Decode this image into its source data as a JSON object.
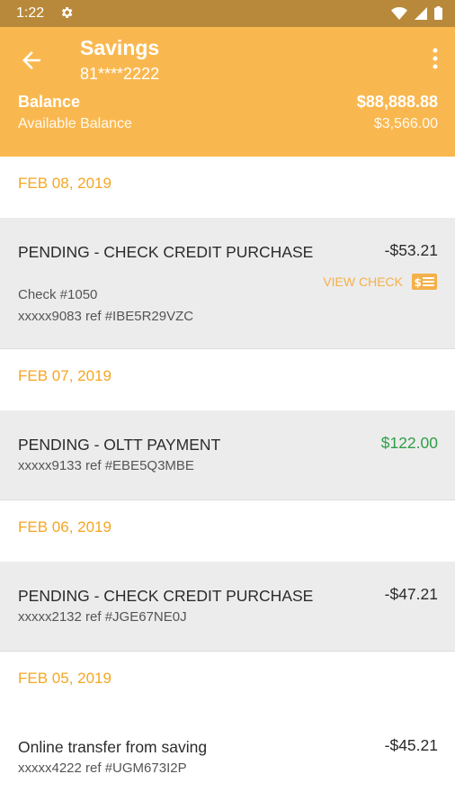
{
  "status": {
    "time": "1:22"
  },
  "header": {
    "title": "Savings",
    "account_number": "81****2222",
    "balance_label": "Balance",
    "balance_value": "$88,888.88",
    "available_label": "Available Balance",
    "available_value": "$3,566.00"
  },
  "groups": [
    {
      "date": "FEB 08, 2019",
      "transactions": [
        {
          "description": "PENDING - CHECK CREDIT PURCHASE",
          "check": "Check #1050",
          "ref": "xxxxx9083 ref #IBE5R29VZC",
          "amount": "-$53.21",
          "action": "VIEW CHECK"
        }
      ]
    },
    {
      "date": "FEB 07, 2019",
      "transactions": [
        {
          "description": "PENDING - OLTT PAYMENT",
          "ref": "xxxxx9133 ref #EBE5Q3MBE",
          "amount": "$122.00"
        }
      ]
    },
    {
      "date": "FEB 06, 2019",
      "transactions": [
        {
          "description": "PENDING - CHECK CREDIT PURCHASE",
          "ref": "xxxxx2132 ref #JGE67NE0J",
          "amount": "-$47.21"
        }
      ]
    },
    {
      "date": "FEB 05, 2019",
      "transactions": [
        {
          "description": "Online transfer from saving",
          "ref": "xxxxx4222 ref #UGM673I2P",
          "amount": "-$45.21"
        }
      ]
    }
  ],
  "colors": {
    "status_bar": "#b8893a",
    "app_bar": "#f9b84f",
    "date_text": "#f5a623",
    "positive_amount": "#2e9e46"
  }
}
